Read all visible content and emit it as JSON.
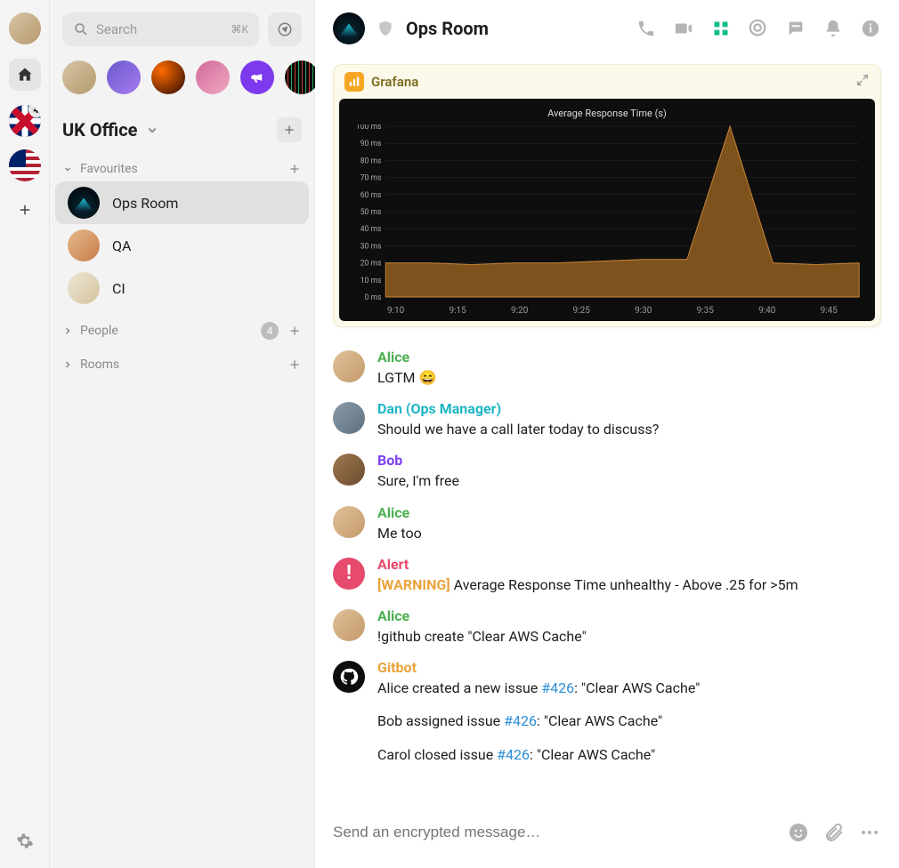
{
  "rail": {
    "uk_badge": "4"
  },
  "search": {
    "placeholder": "Search",
    "kbd": "⌘K"
  },
  "space": {
    "title": "UK Office"
  },
  "sections": {
    "favourites": {
      "label": "Favourites"
    },
    "people": {
      "label": "People",
      "count": "4"
    },
    "rooms": {
      "label": "Rooms"
    }
  },
  "fav_rooms": [
    {
      "name": "Ops Room"
    },
    {
      "name": "QA"
    },
    {
      "name": "CI"
    }
  ],
  "header": {
    "room_title": "Ops Room"
  },
  "grafana": {
    "label": "Grafana",
    "chart_title": "Average Response Time (s)"
  },
  "chart_data": {
    "type": "area",
    "title": "Average Response Time (s)",
    "ylabel": "ms",
    "ylim": [
      0,
      100
    ],
    "y_ticks": [
      "100 ms",
      "90 ms",
      "80 ms",
      "70 ms",
      "60 ms",
      "50 ms",
      "40 ms",
      "30 ms",
      "20 ms",
      "10 ms",
      "0 ms"
    ],
    "x_ticks": [
      "9:10",
      "9:15",
      "9:20",
      "9:25",
      "9:30",
      "9:35",
      "9:40",
      "9:45"
    ],
    "series": [
      {
        "name": "response_time_ms",
        "x": [
          "9:07",
          "9:10",
          "9:15",
          "9:20",
          "9:25",
          "9:30",
          "9:35",
          "9:38",
          "9:39",
          "9:40",
          "9:41",
          "9:45"
        ],
        "values": [
          20,
          20,
          19,
          20,
          20,
          21,
          22,
          22,
          100,
          20,
          19,
          20
        ]
      }
    ]
  },
  "messages": [
    {
      "sender": "Alice",
      "color": "#4caf50",
      "avatar": "av-alice",
      "body": "LGTM 😄"
    },
    {
      "sender": "Dan (Ops Manager)",
      "color": "#1fb6c5",
      "avatar": "av-dan",
      "body": "Should we have a call later today to discuss?"
    },
    {
      "sender": "Bob",
      "color": "#7e3ff2",
      "avatar": "av-bob",
      "body": "Sure, I'm free"
    },
    {
      "sender": "Alice",
      "color": "#4caf50",
      "avatar": "av-alice",
      "body": "Me too"
    },
    {
      "sender": "Alert",
      "color": "#e64a6d",
      "avatar": "av-alert",
      "warning": "[WARNING]",
      "body_after_warning": "Average Response Time unhealthy - Above .25 for >5m"
    },
    {
      "sender": "Alice",
      "color": "#4caf50",
      "avatar": "av-alice",
      "body": "!github create \"Clear AWS Cache\""
    },
    {
      "sender": "Gitbot",
      "color": "#e9a23b",
      "avatar": "av-gitbot",
      "lines": [
        {
          "before": "Alice created a new issue ",
          "link": "#426",
          "after": ": \"Clear AWS Cache\""
        },
        {
          "before": "Bob assigned issue ",
          "link": "#426",
          "after": ": \"Clear AWS Cache\""
        },
        {
          "before": "Carol closed issue ",
          "link": "#426",
          "after": ": \"Clear AWS Cache\""
        }
      ]
    }
  ],
  "composer": {
    "placeholder": "Send an encrypted message…"
  }
}
